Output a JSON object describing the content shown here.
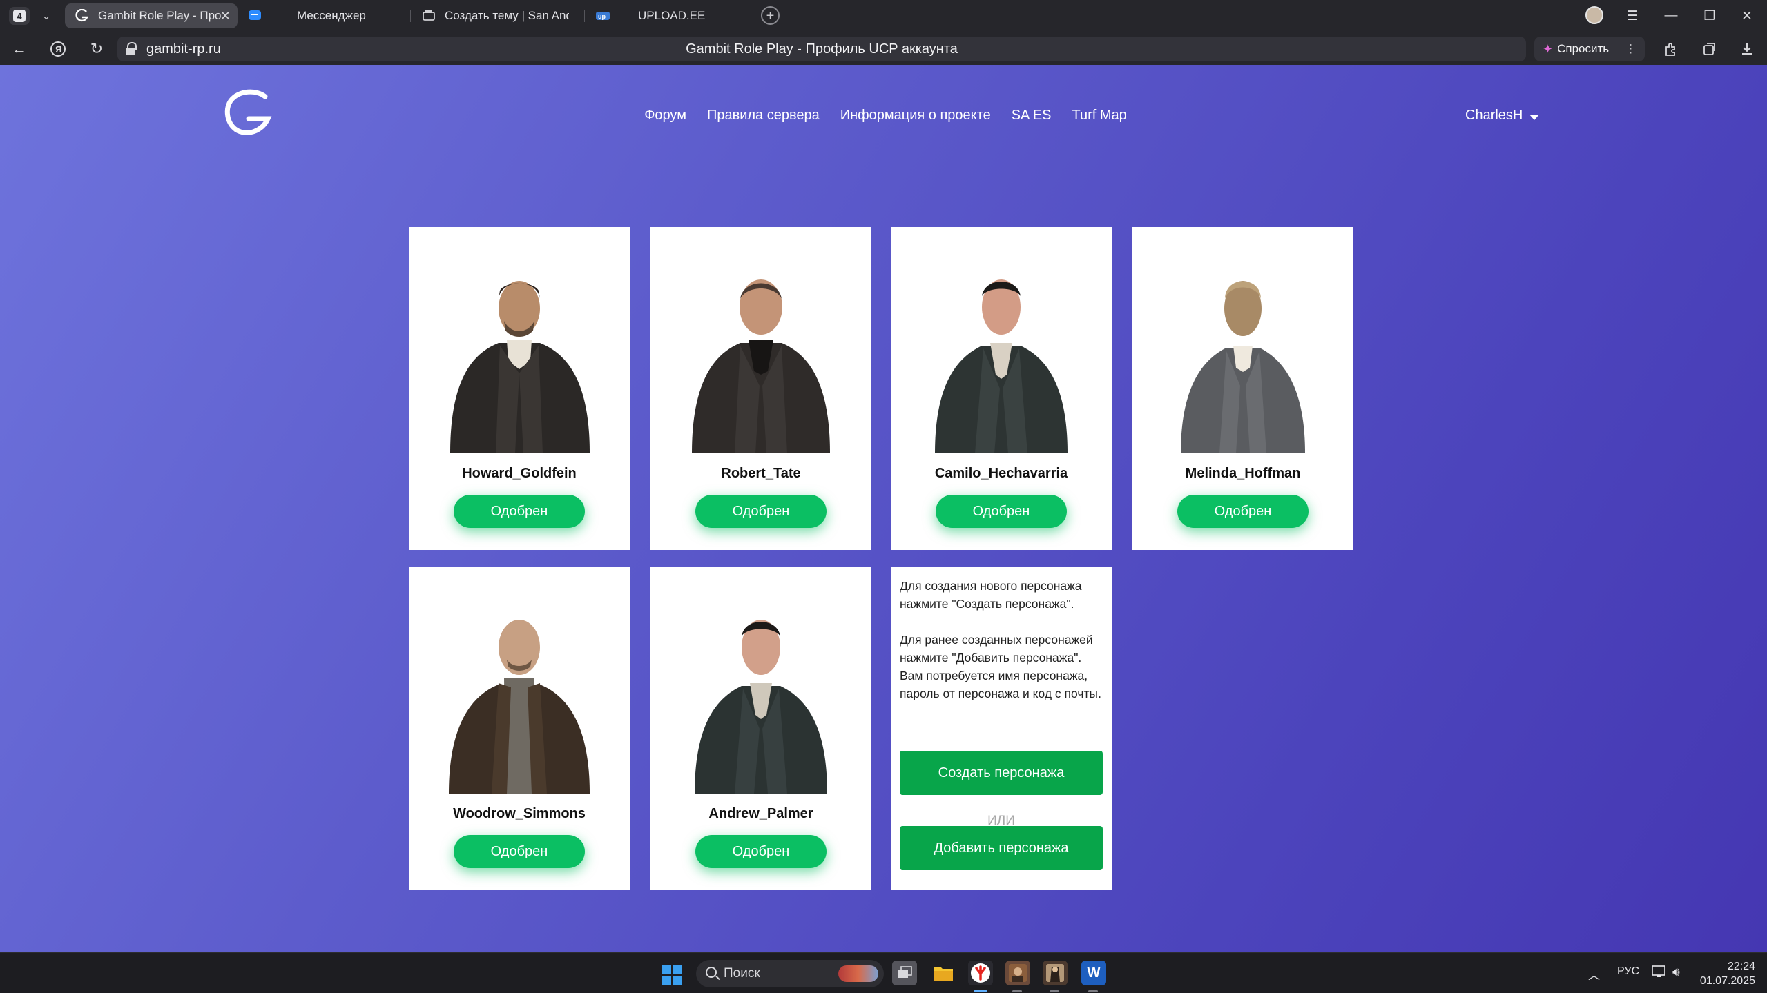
{
  "browser": {
    "tab_count": "4",
    "tabs": [
      {
        "title": "Gambit Role Play - Профиль UCP аккаунта",
        "active": true
      },
      {
        "title": "Мессенджер",
        "active": false
      },
      {
        "title": "Создать тему | San Andreas Extended Society",
        "active": false
      },
      {
        "title": "UPLOAD.EE",
        "active": false
      }
    ],
    "url_domain": "gambit-rp.ru",
    "page_title": "Gambit Role Play - Профиль UCP аккаунта",
    "ask_label": "Спросить"
  },
  "site": {
    "nav": [
      "Форум",
      "Правила сервера",
      "Информация о проекте",
      "SA ES",
      "Turf Map"
    ],
    "username": "CharlesH"
  },
  "characters": [
    {
      "name": "Howard_Goldfein",
      "status": "Одобрен"
    },
    {
      "name": "Robert_Tate",
      "status": "Одобрен"
    },
    {
      "name": "Camilo_Hechavarria",
      "status": "Одобрен"
    },
    {
      "name": "Melinda_Hoffman",
      "status": "Одобрен"
    },
    {
      "name": "Woodrow_Simmons",
      "status": "Одобрен"
    },
    {
      "name": "Andrew_Palmer",
      "status": "Одобрен"
    }
  ],
  "info": {
    "paragraph1": "Для создания нового персонажа нажмите \"Создать персонажа\".",
    "paragraph2": "Для ранее созданных персонажей нажмите \"Добавить персонажа\". Вам потребуется имя персонажа, пароль от персонажа и код с почты.",
    "create_button": "Создать персонажа",
    "or_text": "ИЛИ",
    "add_button": "Добавить персонажа"
  },
  "taskbar": {
    "search_placeholder": "Поиск",
    "language": "РУС",
    "time": "22:24",
    "date": "01.07.2025"
  },
  "colors": {
    "accent_green": "#0bbf63",
    "button_green": "#08a54a",
    "page_gradient_start": "#6e73dc",
    "page_gradient_end": "#4537b2"
  }
}
